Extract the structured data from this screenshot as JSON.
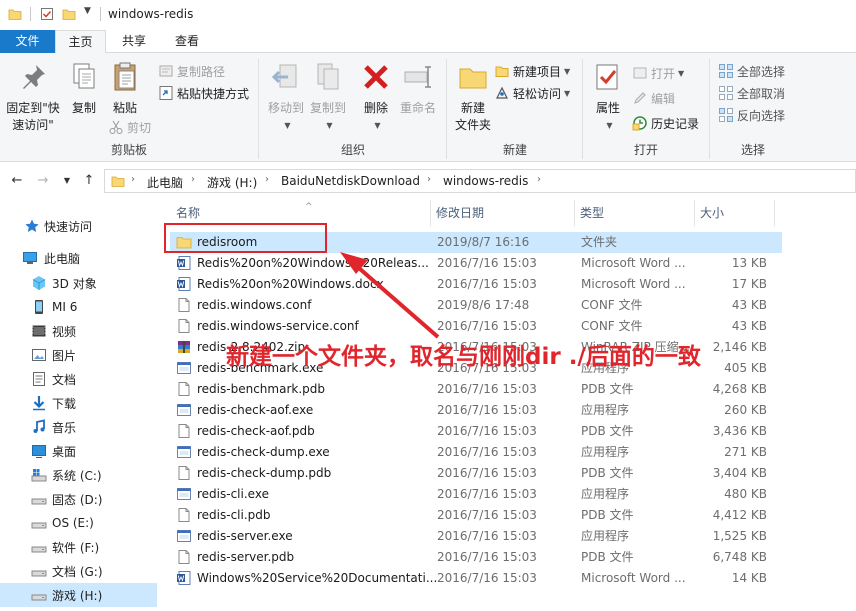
{
  "window": {
    "title": "windows-redis"
  },
  "tabs": {
    "file": "文件",
    "home": "主页",
    "share": "共享",
    "view": "查看"
  },
  "ribbon": {
    "clipboard": {
      "label": "剪贴板",
      "pin": "固定到\"快速访问\"",
      "copy": "复制",
      "paste": "粘贴",
      "copy_path": "复制路径",
      "paste_shortcut": "粘贴快捷方式",
      "cut": "剪切"
    },
    "organize": {
      "label": "组织",
      "move_to": "移动到",
      "copy_to": "复制到",
      "delete": "删除",
      "rename": "重命名"
    },
    "new": {
      "label": "新建",
      "new_folder": "新建\n文件夹",
      "new_item": "新建项目",
      "easy_access": "轻松访问"
    },
    "open": {
      "label": "打开",
      "properties": "属性",
      "open": "打开",
      "edit": "编辑",
      "history": "历史记录"
    },
    "select": {
      "label": "选择",
      "select_all": "全部选择",
      "select_none": "全部取消",
      "invert": "反向选择"
    }
  },
  "address": {
    "crumbs": [
      "此电脑",
      "游戏 (H:)",
      "BaiduNetdiskDownload",
      "windows-redis"
    ]
  },
  "nav": {
    "items": [
      {
        "label": "快速访问",
        "icon": "star-icon"
      },
      {
        "label": "此电脑",
        "icon": "computer-icon"
      },
      {
        "label": "3D 对象",
        "icon": "cube-icon"
      },
      {
        "label": "MI 6",
        "icon": "phone-icon"
      },
      {
        "label": "视频",
        "icon": "video-icon"
      },
      {
        "label": "图片",
        "icon": "picture-icon"
      },
      {
        "label": "文档",
        "icon": "document-icon"
      },
      {
        "label": "下载",
        "icon": "download-icon"
      },
      {
        "label": "音乐",
        "icon": "music-icon"
      },
      {
        "label": "桌面",
        "icon": "desktop-icon"
      },
      {
        "label": "系统 (C:)",
        "icon": "drive-icon"
      },
      {
        "label": "固态 (D:)",
        "icon": "drive-icon"
      },
      {
        "label": "OS (E:)",
        "icon": "drive-icon"
      },
      {
        "label": "软件 (F:)",
        "icon": "drive-icon"
      },
      {
        "label": "文档 (G:)",
        "icon": "drive-icon"
      },
      {
        "label": "游戏 (H:)",
        "icon": "drive-icon"
      }
    ]
  },
  "columns": {
    "name": "名称",
    "date": "修改日期",
    "type": "类型",
    "size": "大小"
  },
  "files": [
    {
      "name": "redisroom",
      "date": "2019/8/7 16:16",
      "type": "文件夹",
      "size": "",
      "icon": "folder-icon"
    },
    {
      "name": "Redis%20on%20Windows%20Releas...",
      "date": "2016/7/16 15:03",
      "type": "Microsoft Word ...",
      "size": "13 KB",
      "icon": "word-icon"
    },
    {
      "name": "Redis%20on%20Windows.docx",
      "date": "2016/7/16 15:03",
      "type": "Microsoft Word ...",
      "size": "17 KB",
      "icon": "word-icon"
    },
    {
      "name": "redis.windows.conf",
      "date": "2019/8/6 17:48",
      "type": "CONF 文件",
      "size": "43 KB",
      "icon": "file-icon"
    },
    {
      "name": "redis.windows-service.conf",
      "date": "2016/7/16 15:03",
      "type": "CONF 文件",
      "size": "43 KB",
      "icon": "file-icon"
    },
    {
      "name": "redis-2.8.2402.zip",
      "date": "2016/7/16 15:03",
      "type": "WinRAR ZIP 压缩...",
      "size": "2,146 KB",
      "icon": "archive-icon"
    },
    {
      "name": "redis-benchmark.exe",
      "date": "2016/7/16 15:03",
      "type": "应用程序",
      "size": "405 KB",
      "icon": "exe-icon"
    },
    {
      "name": "redis-benchmark.pdb",
      "date": "2016/7/16 15:03",
      "type": "PDB 文件",
      "size": "4,268 KB",
      "icon": "file-icon"
    },
    {
      "name": "redis-check-aof.exe",
      "date": "2016/7/16 15:03",
      "type": "应用程序",
      "size": "260 KB",
      "icon": "exe-icon"
    },
    {
      "name": "redis-check-aof.pdb",
      "date": "2016/7/16 15:03",
      "type": "PDB 文件",
      "size": "3,436 KB",
      "icon": "file-icon"
    },
    {
      "name": "redis-check-dump.exe",
      "date": "2016/7/16 15:03",
      "type": "应用程序",
      "size": "271 KB",
      "icon": "exe-icon"
    },
    {
      "name": "redis-check-dump.pdb",
      "date": "2016/7/16 15:03",
      "type": "PDB 文件",
      "size": "3,404 KB",
      "icon": "file-icon"
    },
    {
      "name": "redis-cli.exe",
      "date": "2016/7/16 15:03",
      "type": "应用程序",
      "size": "480 KB",
      "icon": "exe-icon"
    },
    {
      "name": "redis-cli.pdb",
      "date": "2016/7/16 15:03",
      "type": "PDB 文件",
      "size": "4,412 KB",
      "icon": "file-icon"
    },
    {
      "name": "redis-server.exe",
      "date": "2016/7/16 15:03",
      "type": "应用程序",
      "size": "1,525 KB",
      "icon": "exe-icon"
    },
    {
      "name": "redis-server.pdb",
      "date": "2016/7/16 15:03",
      "type": "PDB 文件",
      "size": "6,748 KB",
      "icon": "file-icon"
    },
    {
      "name": "Windows%20Service%20Documentati...",
      "date": "2016/7/16 15:03",
      "type": "Microsoft Word ...",
      "size": "14 KB",
      "icon": "word-icon"
    }
  ],
  "annotation": {
    "text": "新建一个文件夹，取名与刚刚dir ./后面的一致",
    "color": "#e0262c"
  },
  "colors": {
    "accent": "#1979ca",
    "selection": "#cce8ff",
    "annotation": "#e0262c"
  }
}
